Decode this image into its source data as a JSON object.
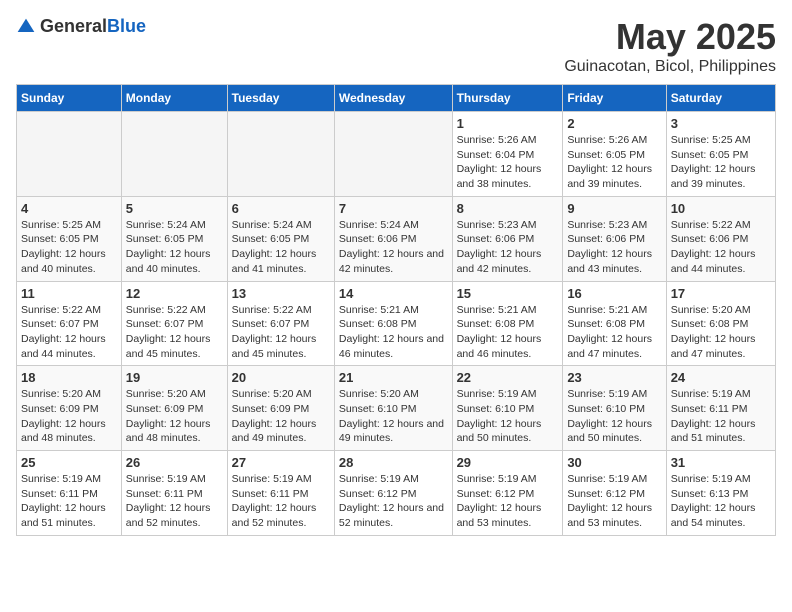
{
  "header": {
    "logo_general": "General",
    "logo_blue": "Blue",
    "title": "May 2025",
    "subtitle": "Guinacotan, Bicol, Philippines"
  },
  "days_of_week": [
    "Sunday",
    "Monday",
    "Tuesday",
    "Wednesday",
    "Thursday",
    "Friday",
    "Saturday"
  ],
  "weeks": [
    [
      {
        "day": "",
        "empty": true
      },
      {
        "day": "",
        "empty": true
      },
      {
        "day": "",
        "empty": true
      },
      {
        "day": "",
        "empty": true
      },
      {
        "day": "1",
        "sunrise": "5:26 AM",
        "sunset": "6:04 PM",
        "daylight": "12 hours and 38 minutes."
      },
      {
        "day": "2",
        "sunrise": "5:26 AM",
        "sunset": "6:05 PM",
        "daylight": "12 hours and 39 minutes."
      },
      {
        "day": "3",
        "sunrise": "5:25 AM",
        "sunset": "6:05 PM",
        "daylight": "12 hours and 39 minutes."
      }
    ],
    [
      {
        "day": "4",
        "sunrise": "5:25 AM",
        "sunset": "6:05 PM",
        "daylight": "12 hours and 40 minutes."
      },
      {
        "day": "5",
        "sunrise": "5:24 AM",
        "sunset": "6:05 PM",
        "daylight": "12 hours and 40 minutes."
      },
      {
        "day": "6",
        "sunrise": "5:24 AM",
        "sunset": "6:05 PM",
        "daylight": "12 hours and 41 minutes."
      },
      {
        "day": "7",
        "sunrise": "5:24 AM",
        "sunset": "6:06 PM",
        "daylight": "12 hours and 42 minutes."
      },
      {
        "day": "8",
        "sunrise": "5:23 AM",
        "sunset": "6:06 PM",
        "daylight": "12 hours and 42 minutes."
      },
      {
        "day": "9",
        "sunrise": "5:23 AM",
        "sunset": "6:06 PM",
        "daylight": "12 hours and 43 minutes."
      },
      {
        "day": "10",
        "sunrise": "5:22 AM",
        "sunset": "6:06 PM",
        "daylight": "12 hours and 44 minutes."
      }
    ],
    [
      {
        "day": "11",
        "sunrise": "5:22 AM",
        "sunset": "6:07 PM",
        "daylight": "12 hours and 44 minutes."
      },
      {
        "day": "12",
        "sunrise": "5:22 AM",
        "sunset": "6:07 PM",
        "daylight": "12 hours and 45 minutes."
      },
      {
        "day": "13",
        "sunrise": "5:22 AM",
        "sunset": "6:07 PM",
        "daylight": "12 hours and 45 minutes."
      },
      {
        "day": "14",
        "sunrise": "5:21 AM",
        "sunset": "6:08 PM",
        "daylight": "12 hours and 46 minutes."
      },
      {
        "day": "15",
        "sunrise": "5:21 AM",
        "sunset": "6:08 PM",
        "daylight": "12 hours and 46 minutes."
      },
      {
        "day": "16",
        "sunrise": "5:21 AM",
        "sunset": "6:08 PM",
        "daylight": "12 hours and 47 minutes."
      },
      {
        "day": "17",
        "sunrise": "5:20 AM",
        "sunset": "6:08 PM",
        "daylight": "12 hours and 47 minutes."
      }
    ],
    [
      {
        "day": "18",
        "sunrise": "5:20 AM",
        "sunset": "6:09 PM",
        "daylight": "12 hours and 48 minutes."
      },
      {
        "day": "19",
        "sunrise": "5:20 AM",
        "sunset": "6:09 PM",
        "daylight": "12 hours and 48 minutes."
      },
      {
        "day": "20",
        "sunrise": "5:20 AM",
        "sunset": "6:09 PM",
        "daylight": "12 hours and 49 minutes."
      },
      {
        "day": "21",
        "sunrise": "5:20 AM",
        "sunset": "6:10 PM",
        "daylight": "12 hours and 49 minutes."
      },
      {
        "day": "22",
        "sunrise": "5:19 AM",
        "sunset": "6:10 PM",
        "daylight": "12 hours and 50 minutes."
      },
      {
        "day": "23",
        "sunrise": "5:19 AM",
        "sunset": "6:10 PM",
        "daylight": "12 hours and 50 minutes."
      },
      {
        "day": "24",
        "sunrise": "5:19 AM",
        "sunset": "6:11 PM",
        "daylight": "12 hours and 51 minutes."
      }
    ],
    [
      {
        "day": "25",
        "sunrise": "5:19 AM",
        "sunset": "6:11 PM",
        "daylight": "12 hours and 51 minutes."
      },
      {
        "day": "26",
        "sunrise": "5:19 AM",
        "sunset": "6:11 PM",
        "daylight": "12 hours and 52 minutes."
      },
      {
        "day": "27",
        "sunrise": "5:19 AM",
        "sunset": "6:11 PM",
        "daylight": "12 hours and 52 minutes."
      },
      {
        "day": "28",
        "sunrise": "5:19 AM",
        "sunset": "6:12 PM",
        "daylight": "12 hours and 52 minutes."
      },
      {
        "day": "29",
        "sunrise": "5:19 AM",
        "sunset": "6:12 PM",
        "daylight": "12 hours and 53 minutes."
      },
      {
        "day": "30",
        "sunrise": "5:19 AM",
        "sunset": "6:12 PM",
        "daylight": "12 hours and 53 minutes."
      },
      {
        "day": "31",
        "sunrise": "5:19 AM",
        "sunset": "6:13 PM",
        "daylight": "12 hours and 54 minutes."
      }
    ]
  ]
}
